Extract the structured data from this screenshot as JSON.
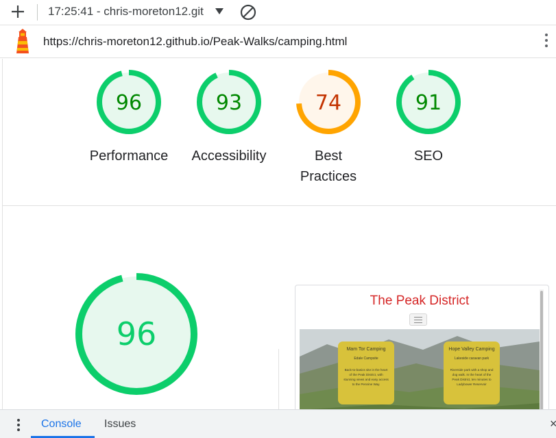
{
  "toolbar": {
    "report_title": "17:25:41 - chris-moreton12.git",
    "new_report_icon": "plus-icon",
    "dropdown_icon": "caret-down-icon",
    "clear_icon": "block-icon"
  },
  "urlbar": {
    "url": "https://chris-moreton12.github.io/Peak-Walks/camping.html",
    "logo_icon": "lighthouse-icon",
    "menu_icon": "more-vertical-icon"
  },
  "scores": [
    {
      "label": "Performance",
      "value": 96,
      "status": "pass"
    },
    {
      "label": "Accessibility",
      "value": 93,
      "status": "pass"
    },
    {
      "label": "Best Practices",
      "value": 74,
      "status": "average"
    },
    {
      "label": "SEO",
      "value": 91,
      "status": "pass"
    }
  ],
  "colors": {
    "pass": "#0cce6b",
    "pass_text": "#008800",
    "pass_bg": "#e7f8ee",
    "average": "#ffa400",
    "average_text": "#c33300",
    "average_bg": "#fff6eb"
  },
  "detail": {
    "score": 96
  },
  "screenshot": {
    "site_title": "The Peak District",
    "cards": [
      {
        "title": "Mam Tor Camping",
        "subtitle": "Edale Campsite",
        "body": "Back-to-basics site in the heart of the Peak District, with stunning views and easy access to the Pennine Way."
      },
      {
        "title": "Hope Valley Camping",
        "subtitle": "Lakeside caravan park",
        "body": "Riverside park with a shop and dog walk. In the heart of the Peak District, ten minutes to Ladybower Reservoir"
      }
    ]
  },
  "console_drawer": {
    "tabs": [
      "Console",
      "Issues"
    ],
    "active_tab": "Console",
    "close_label": "×"
  }
}
